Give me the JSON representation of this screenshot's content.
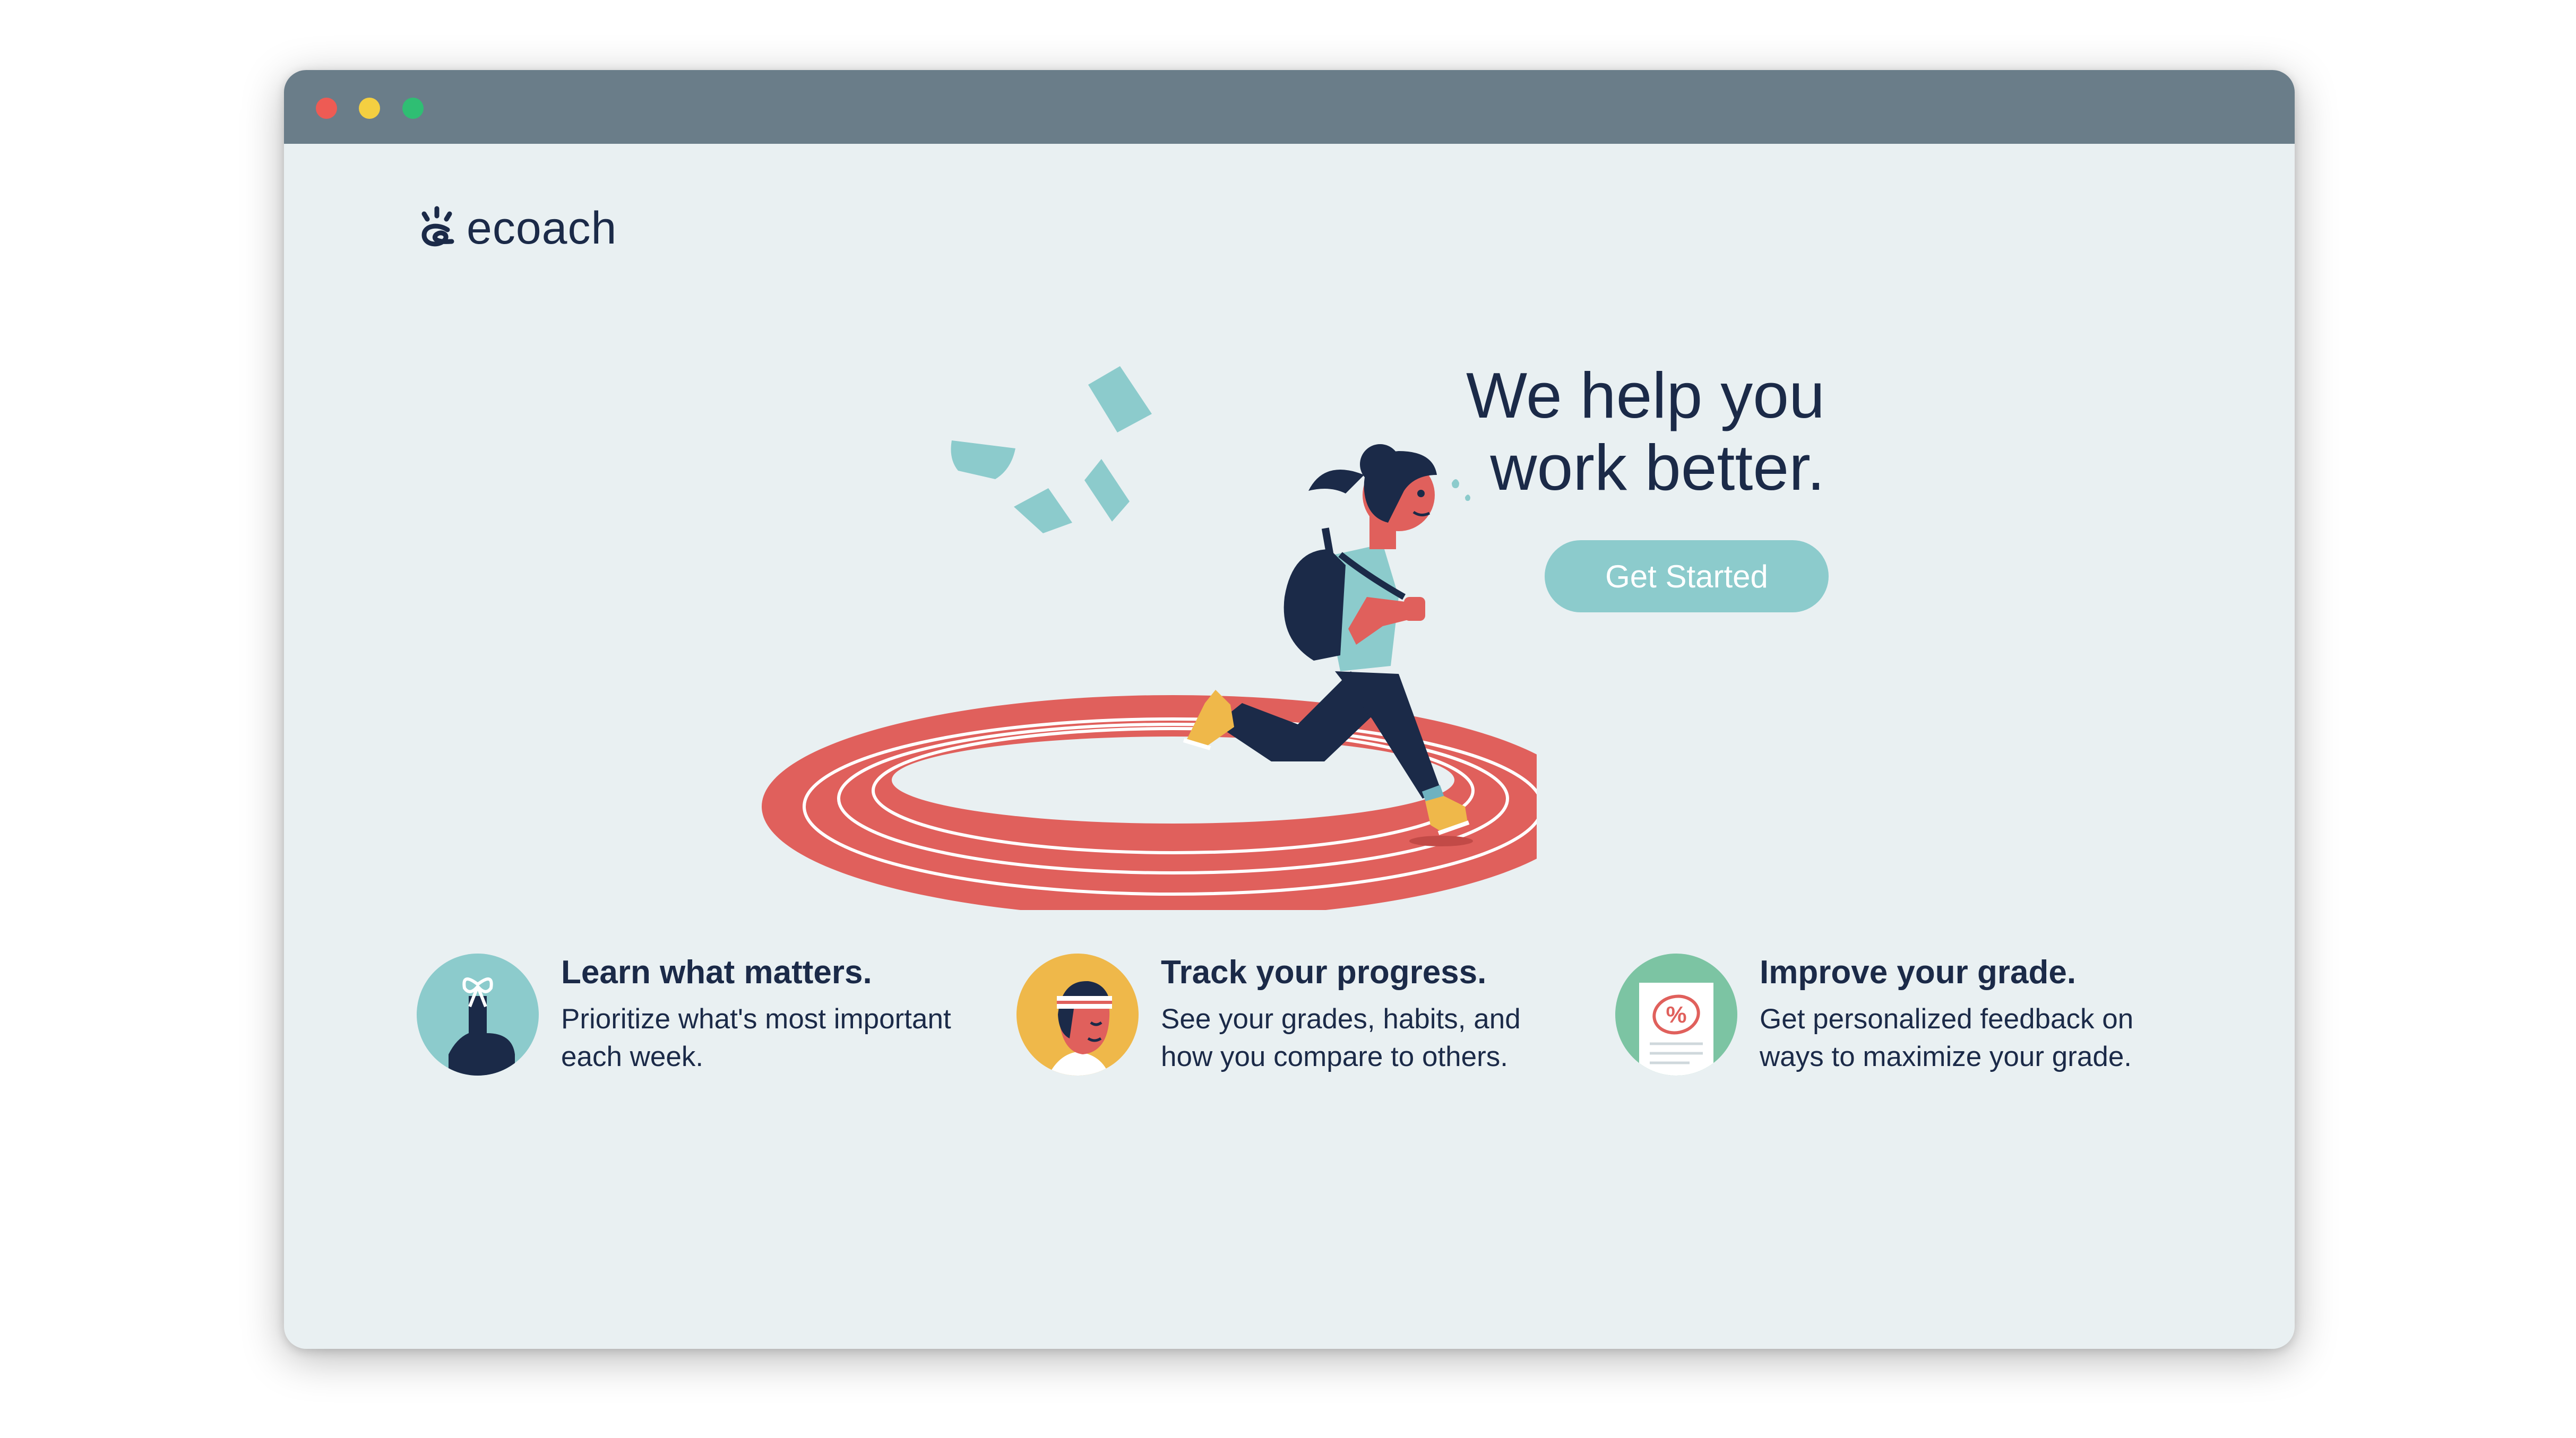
{
  "window": {
    "controls": [
      "close",
      "minimize",
      "maximize"
    ],
    "colors": {
      "titlebar": "#6a7d89",
      "close": "#ee5b54",
      "minimize": "#f4cf41",
      "maximize": "#2fbe73",
      "background": "#e9f0f2"
    }
  },
  "brand": {
    "name": "ecoach",
    "logo_icon": "sprout-swirl-icon",
    "color": "#1b2a48"
  },
  "hero": {
    "headline_line1": "We help you",
    "headline_line2": "work better.",
    "cta_label": "Get Started",
    "cta_color": "#8ccbcc",
    "illustration": "runner-on-track-illustration"
  },
  "features": [
    {
      "icon": "finger-with-bow-icon",
      "icon_bg": "#8ccbcc",
      "title": "Learn what matters.",
      "description": "Prioritize what's most important each week."
    },
    {
      "icon": "headband-runner-icon",
      "icon_bg": "#efb84a",
      "title": "Track your progress.",
      "description": "See your grades, habits, and how you compare to others."
    },
    {
      "icon": "graded-paper-icon",
      "icon_bg": "#7cc4a3",
      "title": "Improve your grade.",
      "description": "Get personalized feedback on ways to maximize your grade."
    }
  ]
}
